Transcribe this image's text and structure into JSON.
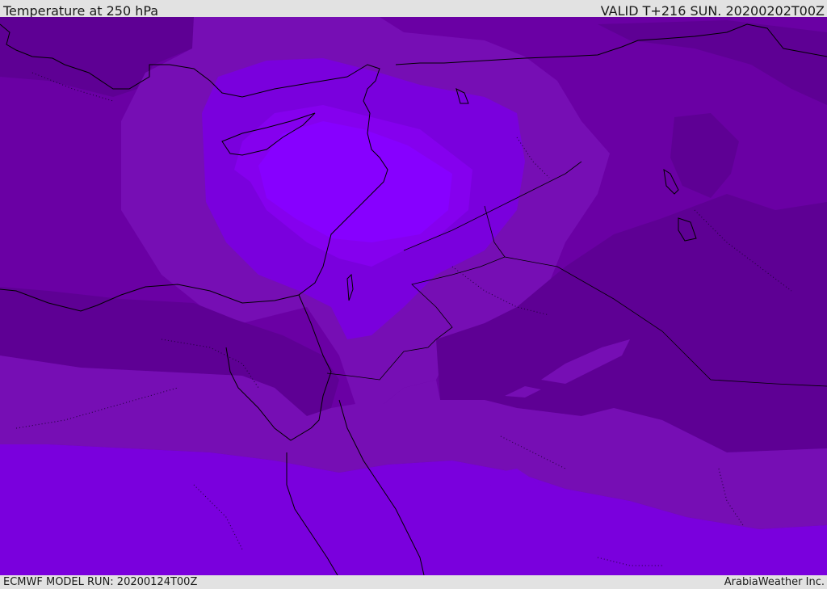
{
  "header": {
    "title": "Temperature at 250 hPa",
    "valid": "VALID T+216 SUN. 20200202T00Z"
  },
  "footer": {
    "model_run": "ECMWF MODEL RUN: 20200124T00Z",
    "credit": "ArabiaWeather Inc."
  },
  "colors": {
    "band_darkest": "#5e0094",
    "band_dark": "#6a00a4",
    "band_mid": "#760eb4",
    "band_purple": "#7a00dd",
    "band_light": "#8500ee",
    "band_lightest": "#8700ff",
    "coastline": "#000000",
    "background": "#e2e2e2"
  }
}
